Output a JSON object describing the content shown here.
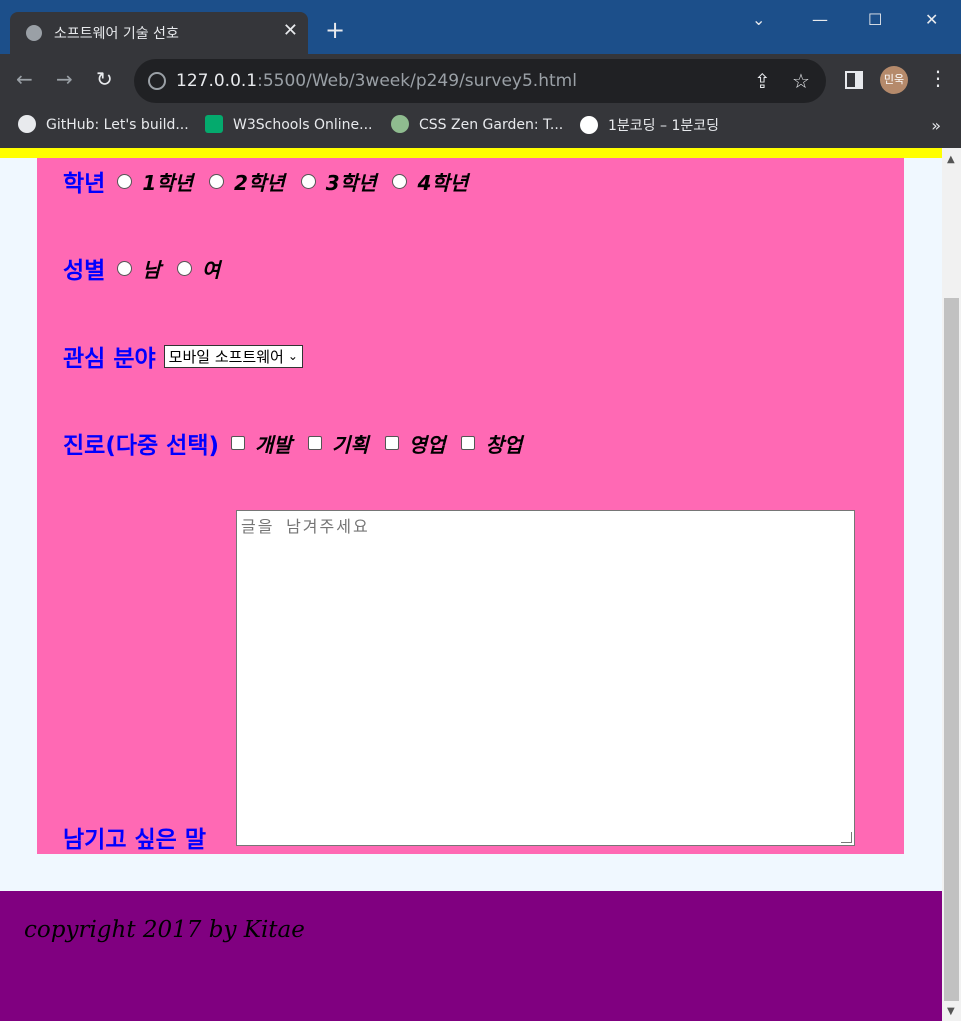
{
  "browser": {
    "tab_title": "소프트웨어 기술 선호",
    "tab_close": "✕",
    "new_tab": "+",
    "url_host": "127.0.0.1",
    "url_rest": ":5500/Web/3week/p249/survey5.html",
    "profile": "민욱",
    "bookmarks": [
      {
        "label": "GitHub: Let's build...",
        "icon": "github-icon"
      },
      {
        "label": "W3Schools Online...",
        "icon": "w3schools-icon"
      },
      {
        "label": "CSS Zen Garden: T...",
        "icon": "zen-garden-icon"
      },
      {
        "label": "1분코딩 – 1분코딩",
        "icon": "1bun-coding-icon"
      }
    ],
    "bookmarks_more": "»"
  },
  "form": {
    "grade": {
      "label": "학년",
      "options": [
        "1학년",
        "2학년",
        "3학년",
        "4학년"
      ]
    },
    "gender": {
      "label": "성별",
      "options": [
        "남",
        "여"
      ]
    },
    "interest": {
      "label": "관심 분야",
      "selected": "모바일 소프트웨어"
    },
    "career": {
      "label": "진로(다중 선택)",
      "options": [
        "개발",
        "기획",
        "영업",
        "창업"
      ]
    },
    "comment": {
      "label": "남기고 싶은 말",
      "placeholder": "글을 남겨주세요"
    }
  },
  "footer": {
    "text": "copyright 2017 by Kitae"
  },
  "colors": {
    "page_bg": "#f0f8ff",
    "strip": "#ffff00",
    "panel": "#ff69b4",
    "label": "#0000ff",
    "footer": "#800080"
  }
}
